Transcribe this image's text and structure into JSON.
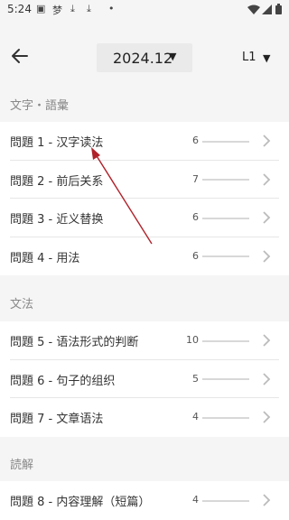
{
  "status": {
    "time": "5:24",
    "notification_icons": [
      "image-icon",
      "notification-icon",
      "download-icon",
      "download-icon",
      "dot-icon"
    ],
    "system_icons": [
      "wifi-icon",
      "signal-icon",
      "battery-icon"
    ]
  },
  "header": {
    "date": "2024.12",
    "date_dropdown_icon": "triangle-down-icon",
    "level": "L1",
    "level_dropdown_icon": "triangle-down-icon",
    "back_icon": "arrow-left-icon"
  },
  "sections": [
    {
      "title": "文字・語彙",
      "items": [
        {
          "label": "問題 1 - 汉字读法",
          "count": "6"
        },
        {
          "label": "問題 2 - 前后关系",
          "count": "7"
        },
        {
          "label": "問題 3 - 近义替换",
          "count": "6"
        },
        {
          "label": "問題 4 - 用法",
          "count": "6"
        }
      ]
    },
    {
      "title": "文法",
      "items": [
        {
          "label": "問題 5 - 语法形式的判断",
          "count": "10"
        },
        {
          "label": "問題 6 - 句子的组织",
          "count": "5"
        },
        {
          "label": "問題 7 - 文章语法",
          "count": "4"
        }
      ]
    },
    {
      "title": "読解",
      "items": [
        {
          "label": "問題 8 - 内容理解（短篇）",
          "count": "4"
        }
      ]
    }
  ],
  "colors": {
    "background": "#f5f5f5",
    "card": "#ffffff",
    "annotation_arrow": "#b0222a"
  }
}
